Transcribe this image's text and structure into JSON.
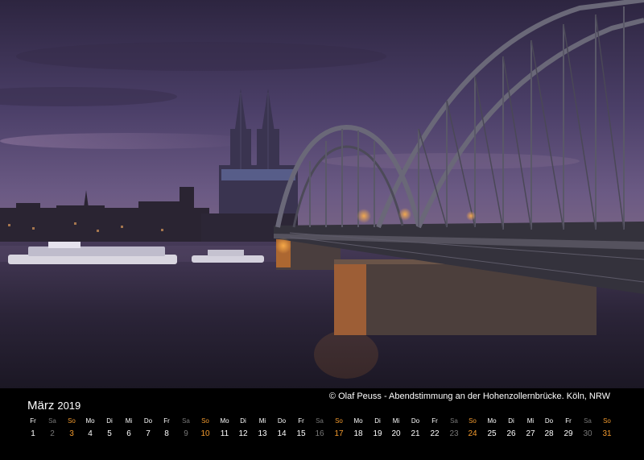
{
  "calendar": {
    "month": "März",
    "year": "2019",
    "credit": "© Olaf Peuss - Abendstimmung an der Hohenzollernbrücke. Köln, NRW",
    "days": [
      {
        "wd": "Fr",
        "d": "1"
      },
      {
        "wd": "Sa",
        "d": "2"
      },
      {
        "wd": "So",
        "d": "3"
      },
      {
        "wd": "Mo",
        "d": "4"
      },
      {
        "wd": "Di",
        "d": "5"
      },
      {
        "wd": "Mi",
        "d": "6"
      },
      {
        "wd": "Do",
        "d": "7"
      },
      {
        "wd": "Fr",
        "d": "8"
      },
      {
        "wd": "Sa",
        "d": "9"
      },
      {
        "wd": "So",
        "d": "10"
      },
      {
        "wd": "Mo",
        "d": "11"
      },
      {
        "wd": "Di",
        "d": "12"
      },
      {
        "wd": "Mi",
        "d": "13"
      },
      {
        "wd": "Do",
        "d": "14"
      },
      {
        "wd": "Fr",
        "d": "15"
      },
      {
        "wd": "Sa",
        "d": "16"
      },
      {
        "wd": "So",
        "d": "17"
      },
      {
        "wd": "Mo",
        "d": "18"
      },
      {
        "wd": "Di",
        "d": "19"
      },
      {
        "wd": "Mi",
        "d": "20"
      },
      {
        "wd": "Do",
        "d": "21"
      },
      {
        "wd": "Fr",
        "d": "22"
      },
      {
        "wd": "Sa",
        "d": "23"
      },
      {
        "wd": "So",
        "d": "24"
      },
      {
        "wd": "Mo",
        "d": "25"
      },
      {
        "wd": "Di",
        "d": "26"
      },
      {
        "wd": "Mi",
        "d": "27"
      },
      {
        "wd": "Do",
        "d": "28"
      },
      {
        "wd": "Fr",
        "d": "29"
      },
      {
        "wd": "Sa",
        "d": "30"
      },
      {
        "wd": "So",
        "d": "31"
      }
    ]
  },
  "colors": {
    "sky": "#4a3d66",
    "water": "#2a2338",
    "bridge": "#3a3a44",
    "sunday": "#f29a2e",
    "saturday": "#777777"
  }
}
